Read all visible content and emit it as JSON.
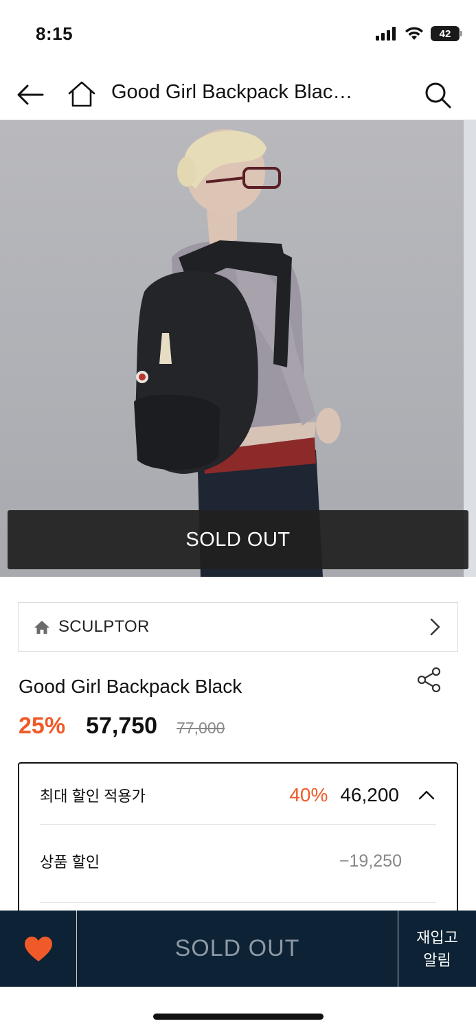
{
  "status_bar": {
    "time": "8:15",
    "battery": "42"
  },
  "nav": {
    "title": "Good Girl Backpack Blac…"
  },
  "product_image": {
    "overlay_label": "SOLD OUT"
  },
  "brand": {
    "name": "SCULPTOR"
  },
  "product": {
    "title": "Good Girl Backpack Black",
    "discount_rate": "25%",
    "sale_price": "57,750",
    "original_price": "77,000"
  },
  "discount_box": {
    "max_label": "최대 할인 적용가",
    "max_rate": "40%",
    "max_price": "46,200",
    "item_label": "상품 할인",
    "item_value": "−19,250"
  },
  "bottom_bar": {
    "soldout_label": "SOLD OUT",
    "restock_label": "재입고\n알림"
  },
  "colors": {
    "accent": "#f05a28",
    "navy": "#0d2234"
  }
}
